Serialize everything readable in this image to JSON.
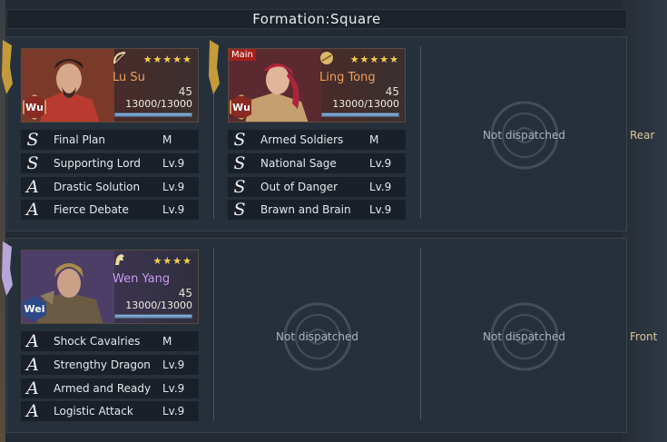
{
  "title": "Formation:Square",
  "rows": {
    "rear_label": "Rear",
    "front_label": "Front"
  },
  "empty_text": "Not dispatched",
  "heroes": [
    {
      "name": "Lu Su",
      "faction": "Wu",
      "level": "45",
      "troops": "13000/13000",
      "stars": "★★★★★",
      "main": "",
      "troop_fill": 1.0,
      "skills": [
        {
          "grade": "S",
          "name": "Final Plan",
          "lv": "M"
        },
        {
          "grade": "S",
          "name": "Supporting Lord",
          "lv": "Lv.9"
        },
        {
          "grade": "A",
          "name": "Drastic Solution",
          "lv": "Lv.9"
        },
        {
          "grade": "A",
          "name": "Fierce Debate",
          "lv": "Lv.9"
        }
      ]
    },
    {
      "name": "Ling Tong",
      "faction": "Wu",
      "level": "45",
      "troops": "13000/13000",
      "stars": "★★★★★",
      "main": "Main",
      "troop_fill": 1.0,
      "skills": [
        {
          "grade": "S",
          "name": "Armed Soldiers",
          "lv": "M"
        },
        {
          "grade": "S",
          "name": "National Sage",
          "lv": "Lv.9"
        },
        {
          "grade": "S",
          "name": "Out of Danger",
          "lv": "Lv.9"
        },
        {
          "grade": "S",
          "name": "Brawn and Brain",
          "lv": "Lv.9"
        }
      ]
    },
    {
      "name": "Wen Yang",
      "faction": "Wei",
      "level": "45",
      "troops": "13000/13000",
      "stars": "★★★★",
      "main": "",
      "troop_fill": 1.0,
      "skills": [
        {
          "grade": "A",
          "name": "Shock Cavalries",
          "lv": "M"
        },
        {
          "grade": "A",
          "name": "Strengthy Dragon",
          "lv": "Lv.9"
        },
        {
          "grade": "A",
          "name": "Armed and Ready",
          "lv": "Lv.9"
        },
        {
          "grade": "A",
          "name": "Logistic Attack",
          "lv": "Lv.9"
        }
      ]
    }
  ],
  "colors": {
    "wu": "#8a2a22",
    "wei": "#2b4a86",
    "star": "#f5cf4e"
  },
  "icons": {
    "lu_su_class": "bow-icon",
    "ling_tong_class": "shield-icon",
    "wen_yang_class": "horse-icon"
  }
}
